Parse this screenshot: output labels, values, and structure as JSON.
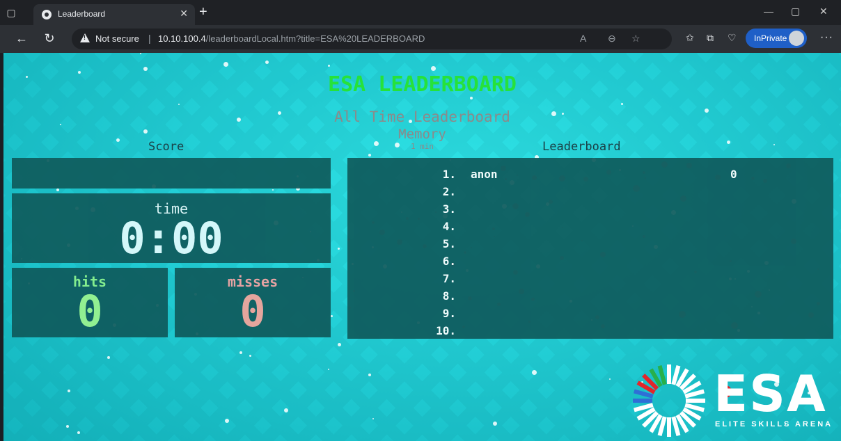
{
  "browser": {
    "tab_title": "Leaderboard",
    "security_label": "Not secure",
    "url_host": "10.10.100.4",
    "url_rest": "/leaderboardLocal.htm?title=ESA%20LEADERBOARD",
    "inprivate_label": "InPrivate"
  },
  "page": {
    "title": "ESA LEADERBOARD",
    "subtitle": "All Time Leaderboard",
    "game": "Memory",
    "duration": "1 min",
    "score_label": "Score",
    "leaderboard_label": "Leaderboard",
    "time_label": "time",
    "time_value": "0:00",
    "hits_label": "hits",
    "hits_value": "0",
    "misses_label": "misses",
    "misses_value": "0"
  },
  "leaderboard": [
    {
      "rank": "1.",
      "name": "anon",
      "score": "0"
    },
    {
      "rank": "2.",
      "name": "",
      "score": ""
    },
    {
      "rank": "3.",
      "name": "",
      "score": ""
    },
    {
      "rank": "4.",
      "name": "",
      "score": ""
    },
    {
      "rank": "5.",
      "name": "",
      "score": ""
    },
    {
      "rank": "6.",
      "name": "",
      "score": ""
    },
    {
      "rank": "7.",
      "name": "",
      "score": ""
    },
    {
      "rank": "8.",
      "name": "",
      "score": ""
    },
    {
      "rank": "9.",
      "name": "",
      "score": ""
    },
    {
      "rank": "10.",
      "name": "",
      "score": ""
    }
  ],
  "logo": {
    "text": "ESA",
    "subtitle": "ELITE SKILLS ARENA"
  },
  "colors": {
    "title_green": "#26e23a",
    "panel_teal": "#0f5b5d",
    "background_cyan": "#22cfd6",
    "hits_green": "#9bf48e",
    "misses_red": "#f4a39a",
    "logo_red": "#e2262b"
  }
}
